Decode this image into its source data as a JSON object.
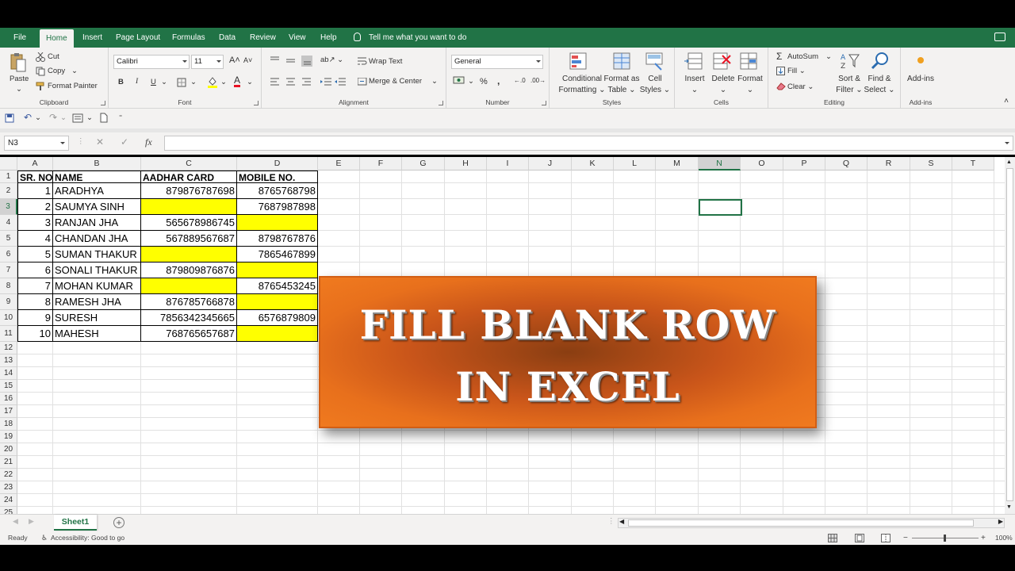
{
  "menubar": {
    "tabs": [
      "File",
      "Home",
      "Insert",
      "Page Layout",
      "Formulas",
      "Data",
      "Review",
      "View",
      "Help"
    ],
    "active": "Home",
    "tell_me": "Tell me what you want to do"
  },
  "ribbon": {
    "clipboard": {
      "paste": "Paste",
      "cut": "Cut",
      "copy": "Copy",
      "format_painter": "Format Painter",
      "label": "Clipboard"
    },
    "font": {
      "name": "Calibri",
      "size": "11",
      "label": "Font",
      "bold": "B",
      "italic": "I",
      "underline": "U",
      "font_color": "A"
    },
    "alignment": {
      "wrap": "Wrap Text",
      "merge": "Merge & Center",
      "label": "Alignment"
    },
    "number": {
      "format": "General",
      "pct": "%",
      "comma": ",",
      "label": "Number"
    },
    "styles": {
      "conditional": "Conditional",
      "conditional2": "Formatting",
      "format_table": "Format as",
      "format_table2": "Table",
      "cell_styles": "Cell",
      "cell_styles2": "Styles",
      "label": "Styles"
    },
    "cells": {
      "insert": "Insert",
      "delete": "Delete",
      "format": "Format",
      "label": "Cells"
    },
    "editing": {
      "autosum": "AutoSum",
      "fill": "Fill",
      "clear": "Clear",
      "sort": "Sort &",
      "sort2": "Filter",
      "find": "Find &",
      "find2": "Select",
      "label": "Editing"
    },
    "addins": {
      "btn": "Add-ins",
      "label": "Add-ins"
    }
  },
  "formula_bar": {
    "name_box": "N3",
    "fx": "fx",
    "value": ""
  },
  "columns": [
    "A",
    "B",
    "C",
    "D",
    "E",
    "F",
    "G",
    "H",
    "I",
    "J",
    "K",
    "L",
    "M",
    "N",
    "O",
    "P",
    "Q",
    "R",
    "S",
    "T"
  ],
  "rows": [
    "1",
    "2",
    "3",
    "4",
    "5",
    "6",
    "7",
    "8",
    "9",
    "10",
    "11",
    "12",
    "13",
    "14",
    "15",
    "16",
    "17",
    "18",
    "19",
    "20",
    "21",
    "22",
    "23",
    "24",
    "25"
  ],
  "table": {
    "headers": [
      "SR. NO",
      "NAME",
      "AADHAR CARD",
      "MOBILE NO."
    ],
    "rows": [
      [
        "1",
        "ARADHYA",
        "879876787698",
        "8765768798"
      ],
      [
        "2",
        "SAUMYA SINH",
        "",
        "7687987898"
      ],
      [
        "3",
        "RANJAN JHA",
        "565678986745",
        ""
      ],
      [
        "4",
        "CHANDAN JHA",
        "567889567687",
        "8798767876"
      ],
      [
        "5",
        "SUMAN THAKUR",
        "",
        "7865467899"
      ],
      [
        "6",
        "SONALI THAKUR",
        "879809876876",
        ""
      ],
      [
        "7",
        "MOHAN KUMAR",
        "",
        "8765453245"
      ],
      [
        "8",
        "RAMESH JHA",
        "876785766878",
        ""
      ],
      [
        "9",
        "SURESH",
        "7856342345665",
        "6576879809"
      ],
      [
        "10",
        "MAHESH",
        "768765657687",
        ""
      ]
    ]
  },
  "banner": {
    "line1": "FILL BLANK ROW",
    "line2": "IN EXCEL"
  },
  "sheet_tab": "Sheet1",
  "status": {
    "ready": "Ready",
    "accessibility": "Accessibility: Good to go",
    "zoom": "100%"
  },
  "colors": {
    "excel_green": "#217346",
    "highlight": "#ffff00",
    "banner": "#e8701c"
  }
}
